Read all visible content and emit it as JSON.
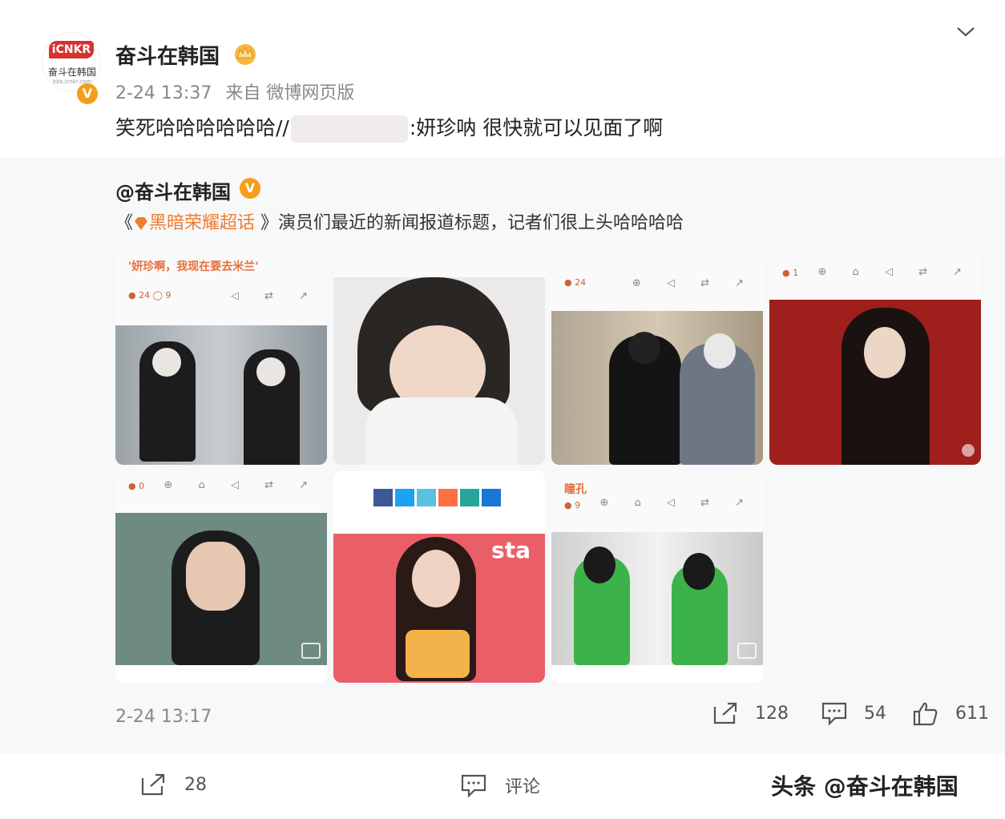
{
  "post": {
    "username": "奋斗在韩国",
    "timestamp": "2-24 13:37",
    "source": "来自 微博网页版",
    "text_before": "笑死哈哈哈哈哈哈//",
    "text_after": ":妍珍呐 很快就可以见面了啊",
    "avatar_logo": "iCNKR",
    "avatar_sub": "奋斗在韩国",
    "avatar_url": "bbs.icnkr.com"
  },
  "repost": {
    "username": "@奋斗在韩国",
    "open_bracket": "《",
    "topic": "黑暗荣耀超话",
    "text": " 》演员们最近的新闻报道标题，记者们很上头哈哈哈哈",
    "images": [
      {
        "headline": "'妍珍啊，我现在要去米兰'"
      },
      {
        "headline": ""
      },
      {
        "headline": ""
      },
      {
        "headline": ""
      },
      {
        "headline": ""
      },
      {
        "headline": "sta"
      },
      {
        "headline": "瞳孔"
      }
    ],
    "date": "2-24 13:17",
    "shares": "128",
    "comments": "54",
    "likes": "611"
  },
  "bottom": {
    "shares": "28",
    "comment_label": "评论"
  },
  "watermark": "头条 @奋斗在韩国",
  "colors": {
    "accent_orange": "#f07c2e",
    "badge": "#f49e1b",
    "logo_red": "#d8322f"
  }
}
